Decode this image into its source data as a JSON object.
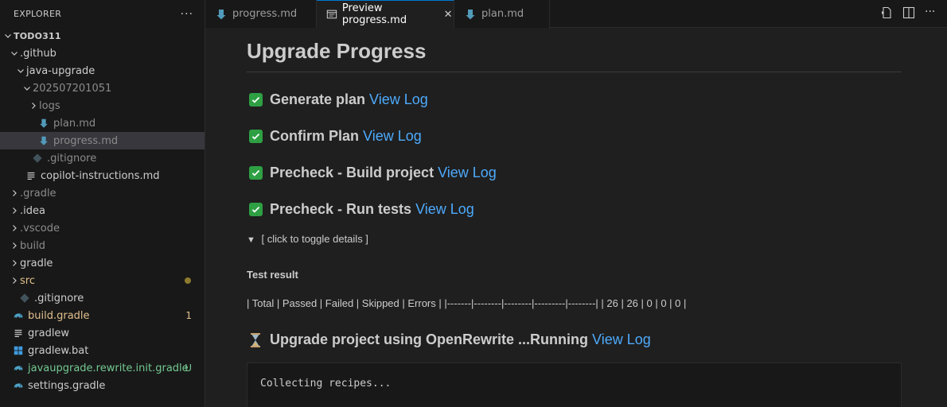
{
  "explorer": {
    "title": "EXPLORER",
    "more": "···",
    "tree": [
      {
        "label": "TODO311",
        "indent": 0,
        "chev": "down",
        "icon": "",
        "style": "bold"
      },
      {
        "label": ".github",
        "indent": 1,
        "chev": "down",
        "icon": "",
        "style": ""
      },
      {
        "label": "java-upgrade",
        "indent": 2,
        "chev": "down",
        "icon": "",
        "style": ""
      },
      {
        "label": "202507201051",
        "indent": 3,
        "chev": "down",
        "icon": "",
        "style": "dim"
      },
      {
        "label": "logs",
        "indent": 4,
        "chev": "right",
        "icon": "",
        "style": "dim"
      },
      {
        "label": "plan.md",
        "indent": 4,
        "chev": "",
        "icon": "markdown",
        "style": "dim"
      },
      {
        "label": "progress.md",
        "indent": 4,
        "chev": "",
        "icon": "markdown",
        "style": "dim",
        "selected": true
      },
      {
        "label": ".gitignore",
        "indent": 3,
        "chev": "",
        "icon": "git",
        "style": "dim"
      },
      {
        "label": "copilot-instructions.md",
        "indent": 2,
        "chev": "",
        "icon": "lines",
        "style": ""
      },
      {
        "label": ".gradle",
        "indent": 1,
        "chev": "right",
        "icon": "",
        "style": "dim"
      },
      {
        "label": ".idea",
        "indent": 1,
        "chev": "right",
        "icon": "",
        "style": ""
      },
      {
        "label": ".vscode",
        "indent": 1,
        "chev": "right",
        "icon": "",
        "style": "dim"
      },
      {
        "label": "build",
        "indent": 1,
        "chev": "right",
        "icon": "",
        "style": "dim"
      },
      {
        "label": "gradle",
        "indent": 1,
        "chev": "right",
        "icon": "",
        "style": ""
      },
      {
        "label": "src",
        "indent": 1,
        "chev": "right",
        "icon": "",
        "style": "yellow",
        "dot": true
      },
      {
        "label": ".gitignore",
        "indent": 1,
        "chev": "",
        "icon": "git",
        "style": ""
      },
      {
        "label": "build.gradle",
        "indent": 0,
        "chev": "",
        "icon": "elephant",
        "style": "yellow",
        "badge": "1",
        "badgeStyle": "yellow"
      },
      {
        "label": "gradlew",
        "indent": 0,
        "chev": "",
        "icon": "lines",
        "style": ""
      },
      {
        "label": "gradlew.bat",
        "indent": 0,
        "chev": "",
        "icon": "windows",
        "style": ""
      },
      {
        "label": "javaupgrade.rewrite.init.gradle",
        "indent": 0,
        "chev": "",
        "icon": "elephant",
        "style": "green",
        "badge": "U",
        "badgeStyle": "green"
      },
      {
        "label": "settings.gradle",
        "indent": 0,
        "chev": "",
        "icon": "elephant",
        "style": ""
      }
    ]
  },
  "tabs": [
    {
      "label": "progress.md",
      "icon": "markdown",
      "active": false
    },
    {
      "label": "Preview progress.md",
      "icon": "preview",
      "active": true,
      "close": "✕"
    },
    {
      "label": "plan.md",
      "icon": "markdown",
      "active": false
    }
  ],
  "preview": {
    "title": "Upgrade Progress",
    "steps": [
      {
        "text": "Generate plan",
        "link": "View Log",
        "status": "done"
      },
      {
        "text": "Confirm Plan",
        "link": "View Log",
        "status": "done"
      },
      {
        "text": "Precheck - Build project",
        "link": "View Log",
        "status": "done"
      },
      {
        "text": "Precheck - Run tests",
        "link": "View Log",
        "status": "done"
      }
    ],
    "details_arrow": "▼",
    "details_label": "[ click to toggle details ]",
    "test_heading": "Test result",
    "test_table": "| Total | Passed | Failed | Skipped | Errors | |-------|--------|--------|---------|--------| | 26 | 26 | 0 | 0 | 0 |",
    "running_step": {
      "text": "Upgrade project using OpenRewrite ...Running",
      "link": "View Log",
      "status": "running"
    },
    "code": "Collecting recipes..."
  },
  "colors": {
    "accent": "#0078d4",
    "link": "#4daafc",
    "check_green": "#2ea043",
    "modified_yellow": "#e2c08d",
    "untracked_green": "#73c991"
  }
}
